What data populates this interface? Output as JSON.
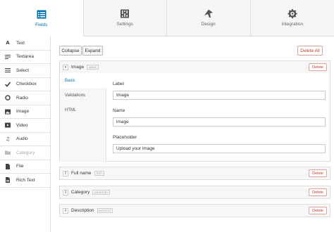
{
  "top_tabs": [
    {
      "label": "Fields",
      "icon": "fields-icon",
      "active": true
    },
    {
      "label": "Settings",
      "icon": "settings-icon",
      "active": false
    },
    {
      "label": "Design",
      "icon": "design-icon",
      "active": false
    },
    {
      "label": "Integration",
      "icon": "integration-icon",
      "active": false
    }
  ],
  "sidebar": {
    "items": [
      {
        "label": "Text",
        "icon": "text-icon"
      },
      {
        "label": "Textarea",
        "icon": "textarea-icon"
      },
      {
        "label": "Select",
        "icon": "select-icon"
      },
      {
        "label": "Checkbox",
        "icon": "checkbox-icon"
      },
      {
        "label": "Radio",
        "icon": "radio-icon"
      },
      {
        "label": "Image",
        "icon": "image-icon"
      },
      {
        "label": "Video",
        "icon": "video-icon"
      },
      {
        "label": "Audio",
        "icon": "audio-icon"
      },
      {
        "label": "Category",
        "icon": "category-icon",
        "disabled": true
      },
      {
        "label": "File",
        "icon": "file-icon"
      },
      {
        "label": "Rich Text",
        "icon": "rich-text-icon"
      }
    ]
  },
  "toolbar": {
    "collapse_label": "Collapse",
    "expand_label": "Expand",
    "delete_all_label": "Delete All"
  },
  "expanded_field": {
    "title": "Image",
    "badge": "image",
    "delete_label": "Delete",
    "subtabs": [
      "Basic",
      "Validations",
      "HTML"
    ],
    "label_caption": "Label",
    "label_value": "Image",
    "name_caption": "Name",
    "name_value": "image",
    "placeholder_caption": "Placeholder",
    "placeholder_value": "Upload your image"
  },
  "collapsed_fields": [
    {
      "number": "2",
      "title": "Full name",
      "badge": "text",
      "delete_label": "Delete"
    },
    {
      "number": "3",
      "title": "Category",
      "badge": "category",
      "delete_label": "Delete"
    },
    {
      "number": "4",
      "title": "Description",
      "badge": "richtext",
      "delete_label": "Delete"
    }
  ],
  "colors": {
    "accent": "#0073aa",
    "danger": "#c0392b"
  }
}
